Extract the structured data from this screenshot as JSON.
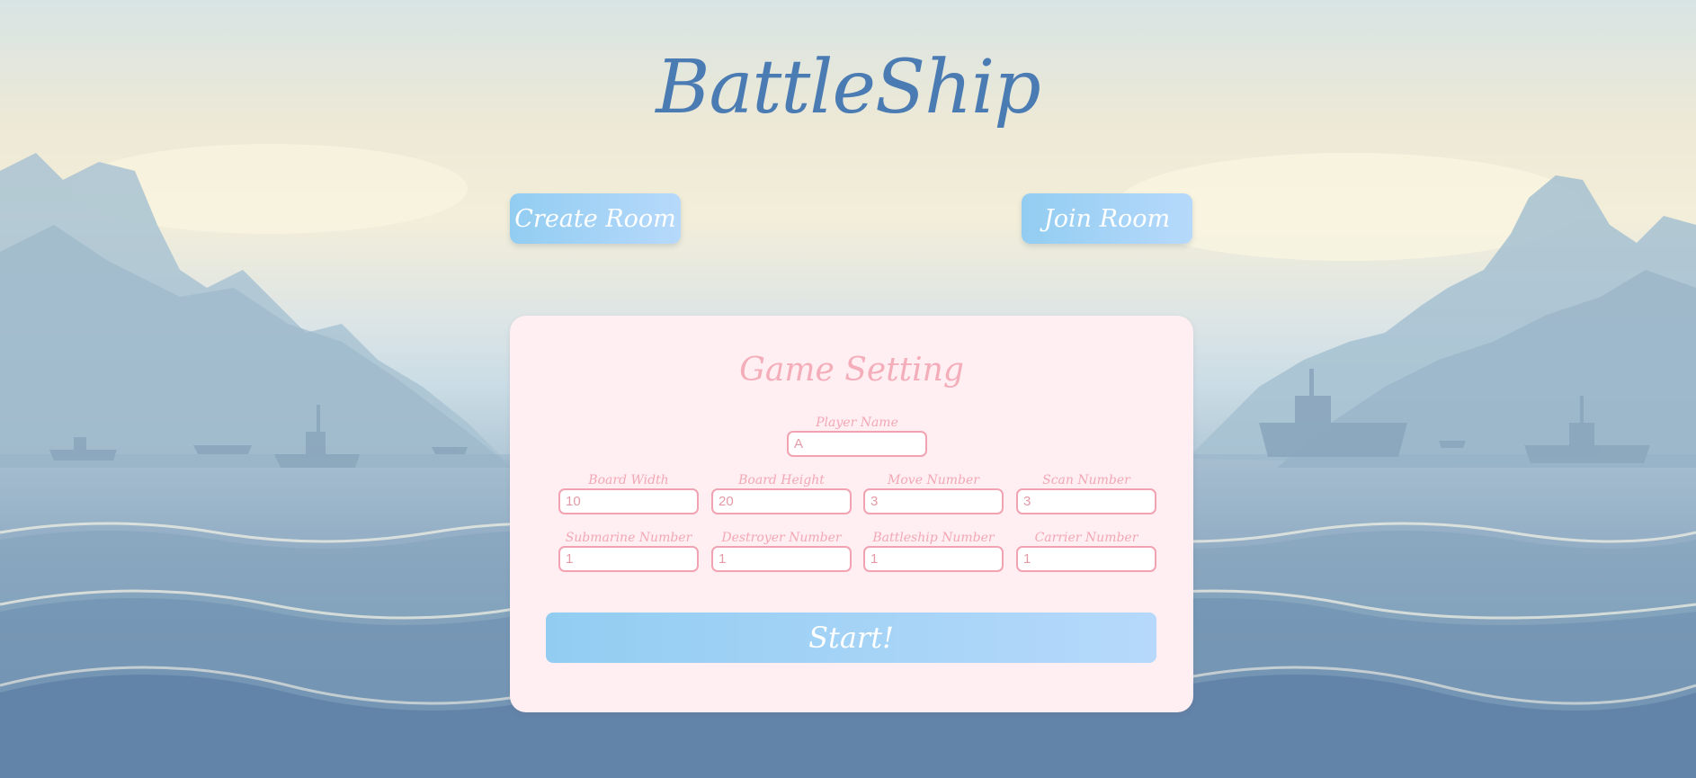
{
  "app": {
    "title": "BattleShip"
  },
  "top_buttons": {
    "create_room": "Create Room",
    "join_room": "Join Room"
  },
  "settings": {
    "title": "Game Setting",
    "player_name": {
      "label": "Player Name",
      "value": "A"
    },
    "board_width": {
      "label": "Board Width",
      "value": "10"
    },
    "board_height": {
      "label": "Board Height",
      "value": "20"
    },
    "move_number": {
      "label": "Move Number",
      "value": "3"
    },
    "scan_number": {
      "label": "Scan Number",
      "value": "3"
    },
    "submarine_number": {
      "label": "Submarine Number",
      "value": "1"
    },
    "destroyer_number": {
      "label": "Destroyer Number",
      "value": "1"
    },
    "battleship_number": {
      "label": "Battleship Number",
      "value": "1"
    },
    "carrier_number": {
      "label": "Carrier Number",
      "value": "1"
    },
    "start_label": "Start!"
  },
  "colors": {
    "title": "#4a7bb3",
    "button_gradient_start": "#92cdf1",
    "button_gradient_end": "#b6d9fb",
    "panel_bg": "#ffeef2",
    "pink_accent": "#f2a3b1"
  }
}
